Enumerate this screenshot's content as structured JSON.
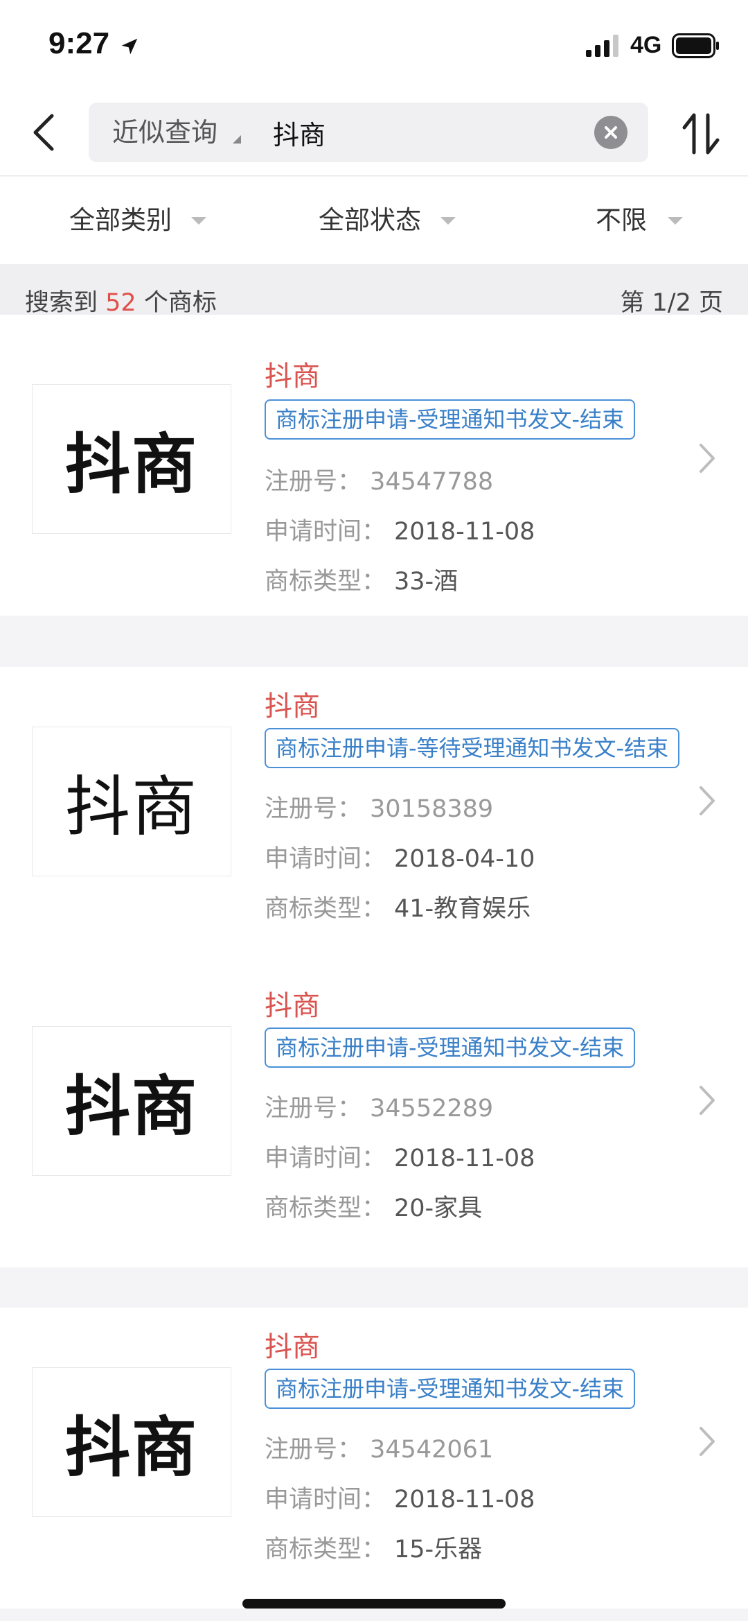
{
  "status_bar": {
    "time": "9:27",
    "network": "4G"
  },
  "nav": {
    "search_mode": "近似查询",
    "search_value": "抖商"
  },
  "filters": [
    {
      "label": "全部类别"
    },
    {
      "label": "全部状态"
    },
    {
      "label": "不限"
    }
  ],
  "summary": {
    "prefix": "搜索到 ",
    "count": "52",
    "suffix": " 个商标",
    "page": "第 1/2 页"
  },
  "labels": {
    "reg_no": "注册号：",
    "apply_date": "申请时间：",
    "class": "商标类型："
  },
  "results": [
    {
      "logo_text": "抖商",
      "name": "抖商",
      "status": "商标注册申请-受理通知书发文-结束",
      "reg_no": "34547788",
      "apply_date": "2018-11-08",
      "class": "33-酒"
    },
    {
      "logo_text": "抖商",
      "name": "抖商",
      "status": "商标注册申请-等待受理通知书发文-结束",
      "reg_no": "30158389",
      "apply_date": "2018-04-10",
      "class": "41-教育娱乐"
    },
    {
      "logo_text": "抖商",
      "name": "抖商",
      "status": "商标注册申请-受理通知书发文-结束",
      "reg_no": "34552289",
      "apply_date": "2018-11-08",
      "class": "20-家具"
    },
    {
      "logo_text": "抖商",
      "name": "抖商",
      "status": "商标注册申请-受理通知书发文-结束",
      "reg_no": "34542061",
      "apply_date": "2018-11-08",
      "class": "15-乐器"
    }
  ],
  "colors": {
    "accent_red": "#e0504a",
    "status_blue": "#3a80c8"
  },
  "icons": [
    "location-arrow-icon",
    "signal-icon",
    "battery-icon",
    "back-chevron-icon",
    "dropdown-caret-icon",
    "clear-icon",
    "sort-icon",
    "chevron-right-icon"
  ]
}
